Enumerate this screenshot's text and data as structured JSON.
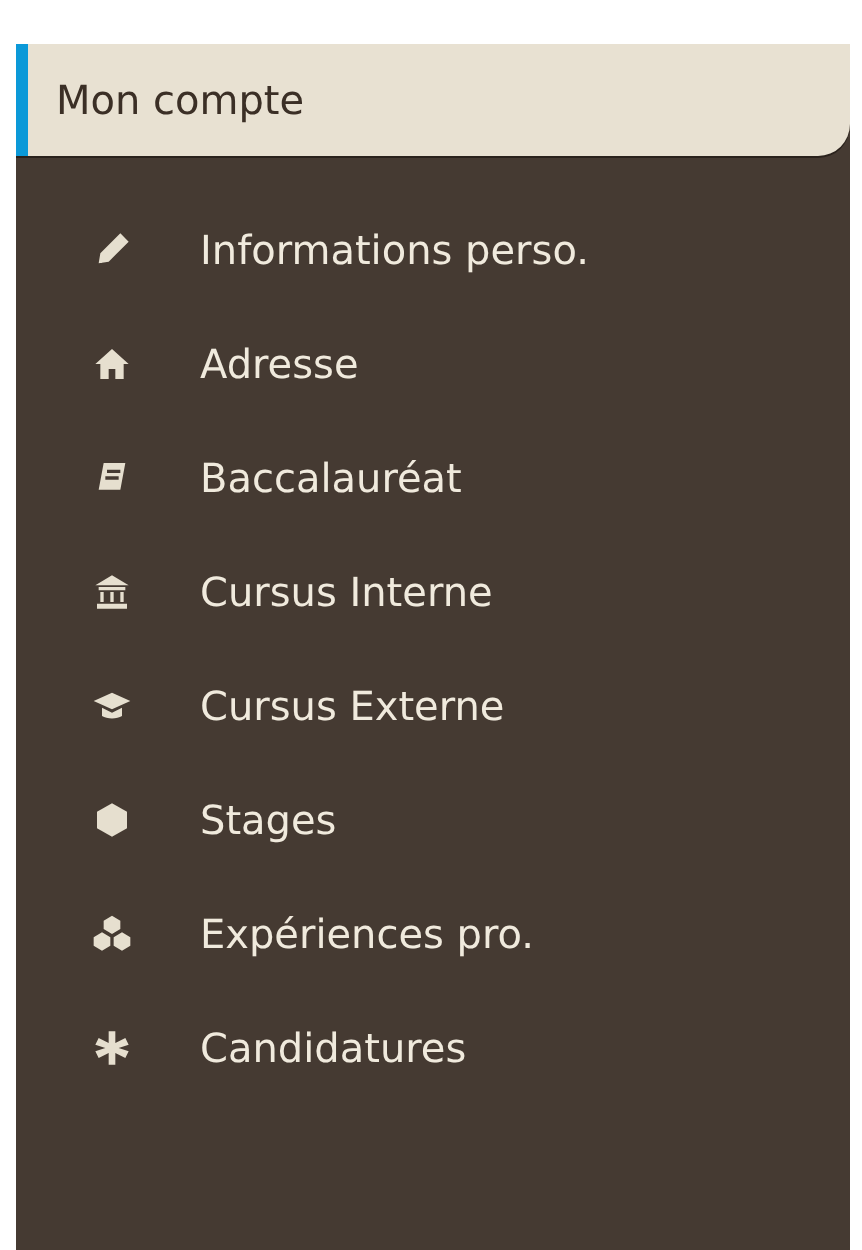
{
  "menu": {
    "title": "Mon compte",
    "items": [
      {
        "label": "Informations perso."
      },
      {
        "label": "Adresse"
      },
      {
        "label": "Baccalauréat"
      },
      {
        "label": "Cursus Interne"
      },
      {
        "label": "Cursus Externe"
      },
      {
        "label": "Stages"
      },
      {
        "label": "Expériences pro."
      },
      {
        "label": "Candidatures"
      }
    ]
  }
}
